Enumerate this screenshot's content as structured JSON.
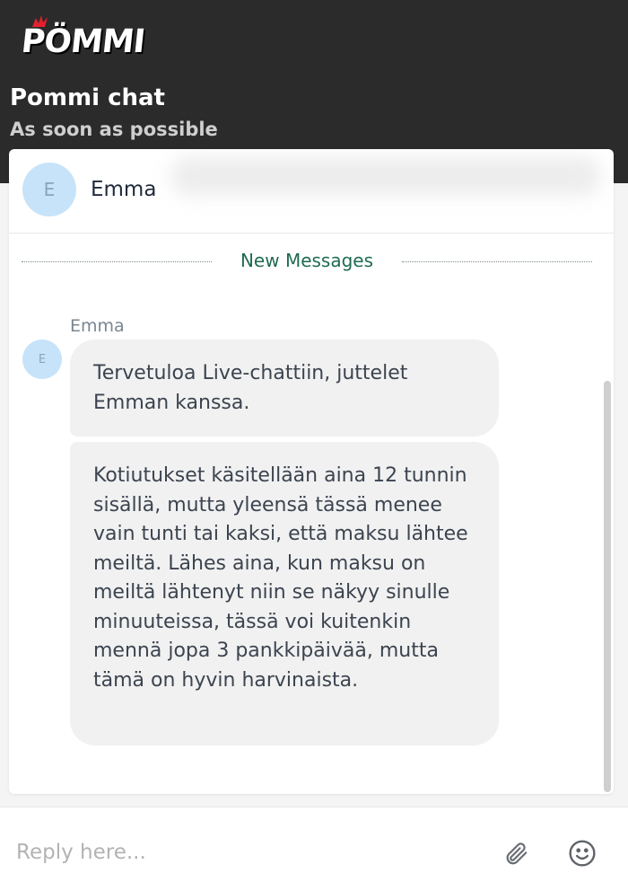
{
  "header": {
    "logo_text": "PÖMMI",
    "title": "Pommi chat",
    "subtitle": "As soon as possible"
  },
  "agent": {
    "initial": "E",
    "name": "Emma"
  },
  "divider": {
    "label": "New Messages"
  },
  "messages": {
    "sender_name": "Emma",
    "avatar_initial": "E",
    "items": [
      {
        "text": "Tervetuloa Live-chattiin, juttelet Emman kanssa."
      },
      {
        "text": "Kotiutukset käsitellään aina 12 tunnin sisällä, mutta yleensä tässä menee vain tunti tai kaksi, että maksu lähtee meiltä. Lähes aina, kun maksu on meiltä lähtenyt niin se näkyy sinulle minuuteissa, tässä voi kuitenkin mennä jopa 3 pankkipäivää, mutta tämä on hyvin harvinaista."
      }
    ]
  },
  "composer": {
    "placeholder": "Reply here...",
    "value": ""
  },
  "icons": {
    "attach": "paperclip-icon",
    "emoji": "smiley-icon"
  },
  "colors": {
    "header_bg": "#2b2b2b",
    "accent_green": "#1f6b53",
    "avatar_bg": "#c7e3f9",
    "bubble_bg": "#f1f1f1",
    "logo_red": "#e5202e"
  }
}
